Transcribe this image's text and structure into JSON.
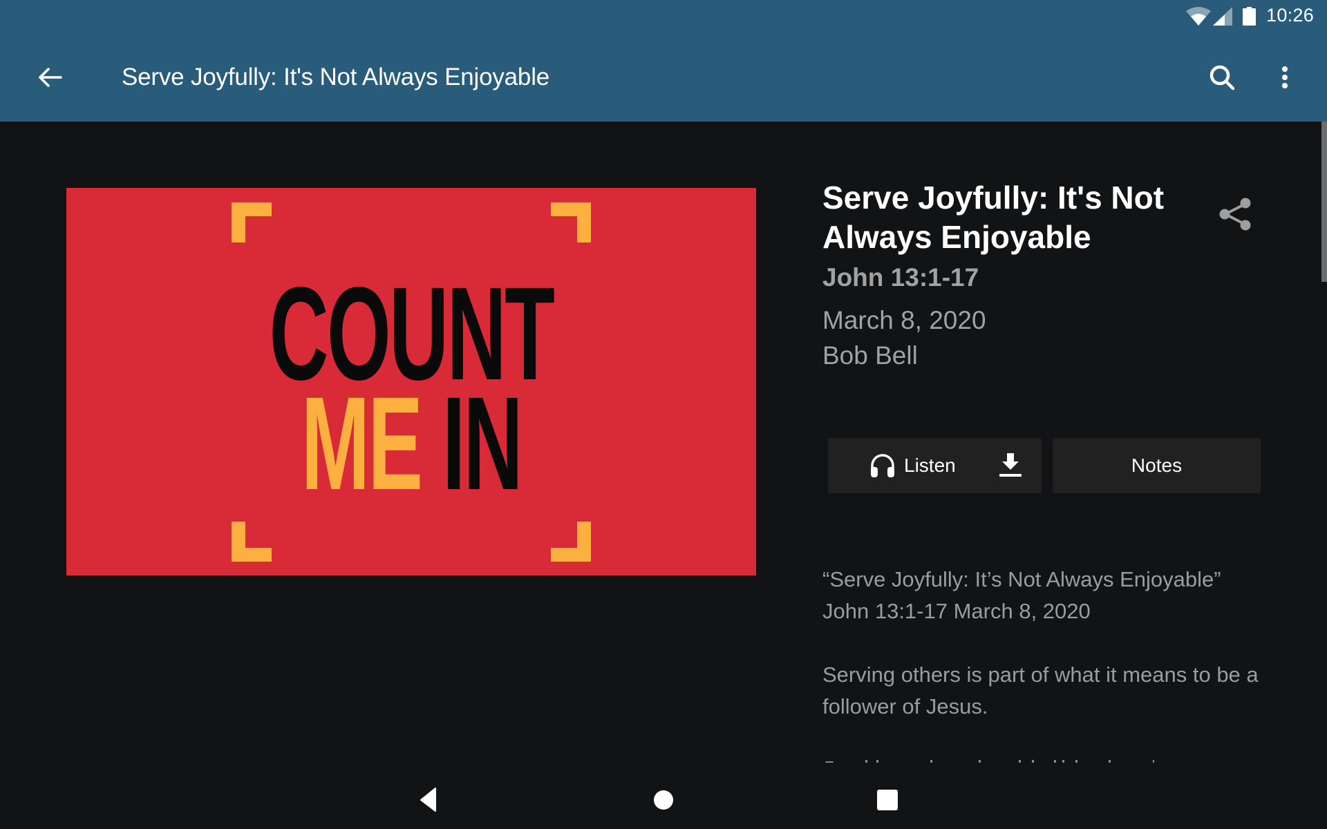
{
  "status_bar": {
    "time": "10:26",
    "icons": [
      "wifi-icon",
      "cell-signal-icon",
      "battery-icon"
    ]
  },
  "toolbar": {
    "title": "Serve Joyfully: It's Not Always Enjoyable",
    "back_icon": "arrow-back-icon",
    "search_icon": "search-icon",
    "more_icon": "more-vertical-icon"
  },
  "artwork": {
    "line1": "COUNT",
    "line2_a": "ME",
    "line2_b": "IN",
    "colors": {
      "background": "#d92b37",
      "accent": "#fbb040",
      "text": "#0a0a0a"
    }
  },
  "sermon": {
    "title": "Serve Joyfully: It's Not Always Enjoyable",
    "scripture": "John 13:1-17",
    "date": "March 8, 2020",
    "speaker": "Bob Bell",
    "share_icon": "share-icon"
  },
  "actions": {
    "listen_label": "Listen",
    "listen_icon": "headphones-icon",
    "download_icon": "download-icon",
    "notes_label": "Notes"
  },
  "description": {
    "paragraphs": [
      "“Serve Joyfully: It’s Not Always Enjoyable” John 13:1-17 March 8, 2020",
      "Serving others is part of what it means to be a follower of Jesus."
    ]
  },
  "nav_bar": {
    "back": "nav-back-icon",
    "home": "nav-home-icon",
    "recents": "nav-recents-icon"
  },
  "colors": {
    "app_bar": "#295c7a",
    "background": "#121315",
    "button_bg": "#212121",
    "secondary_text": "#a2a2a2"
  }
}
